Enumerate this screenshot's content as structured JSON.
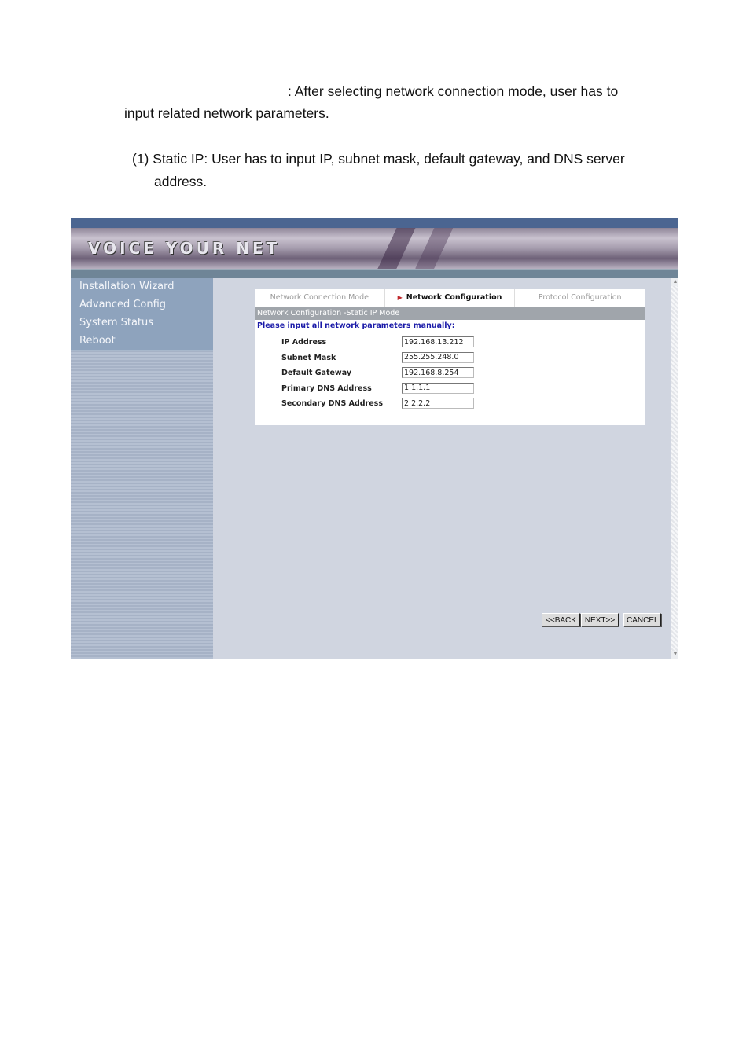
{
  "document": {
    "paragraph1_line1": ": After selecting network connection mode, user has to",
    "paragraph1_line2": "input related network parameters.",
    "item1_line1": "(1) Static IP: User has to input IP, subnet mask, default gateway, and DNS server",
    "item1_line2": "address."
  },
  "screenshot": {
    "banner_title": "VOICE YOUR NET",
    "sidebar": {
      "items": [
        {
          "label": "Installation Wizard"
        },
        {
          "label": "Advanced Config"
        },
        {
          "label": "System Status"
        },
        {
          "label": "Reboot"
        }
      ]
    },
    "wizard": {
      "steps": [
        {
          "label": "Network Connection Mode",
          "active": false
        },
        {
          "label": "Network Configuration",
          "active": true
        },
        {
          "label": "Protocol Configuration",
          "active": false
        }
      ],
      "active_marker": "▶",
      "section_header": "Network Configuration -Static IP Mode",
      "instruction": "Please input all network parameters manually:",
      "fields": [
        {
          "label": "IP Address",
          "value": "192.168.13.212"
        },
        {
          "label": "Subnet Mask",
          "value": "255.255.248.0"
        },
        {
          "label": "Default Gateway",
          "value": "192.168.8.254"
        },
        {
          "label": "Primary DNS Address",
          "value": "1.1.1.1"
        },
        {
          "label": "Secondary DNS Address",
          "value": "2.2.2.2"
        }
      ]
    },
    "buttons": {
      "back": "<<BACK",
      "next": "NEXT>>",
      "cancel": "CANCEL"
    },
    "scrollbar": {
      "up_arrow": "▲",
      "down_arrow": "▼"
    },
    "colors": {
      "topbar": "#4b6591",
      "sidebar_item": "#8ea3bd",
      "content_bg": "#d0d5e0",
      "section_header": "#a0a5ab",
      "instruction_text": "#1a1aa8",
      "active_marker": "#c0282d"
    }
  }
}
